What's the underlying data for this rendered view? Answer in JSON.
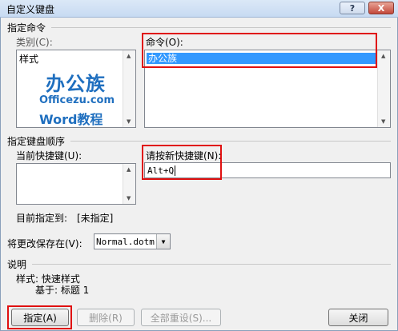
{
  "window": {
    "title": "自定义键盘",
    "help_glyph": "?",
    "close_glyph": "X"
  },
  "specify_command": {
    "group_label": "指定命令",
    "category_label": "类别(C):",
    "categories": [
      "样式"
    ],
    "command_label": "命令(O):",
    "commands": [
      "办公族"
    ]
  },
  "logo": {
    "line1": "办公族",
    "line2": "Officezu.com",
    "line3": "Word教程"
  },
  "keyboard_sequence": {
    "group_label": "指定键盘顺序",
    "current_keys_label": "当前快捷键(U):",
    "new_key_label": "请按新快捷键(N):",
    "new_key_value": "Alt+Q",
    "assigned_label": "目前指定到:",
    "assigned_value": "[未指定]"
  },
  "save_in": {
    "label": "将更改保存在(V):",
    "value": "Normal.dotm"
  },
  "description": {
    "group_label": "说明",
    "line1": "样式: 快速样式",
    "line2": "基于: 标题 1"
  },
  "buttons": {
    "assign": "指定(A)",
    "remove": "删除(R)",
    "reset_all": "全部重设(S)...",
    "close": "关闭"
  },
  "colors": {
    "highlight": "#e01010",
    "selection": "#3399ff",
    "logo_blue": "#1f6fbf"
  }
}
